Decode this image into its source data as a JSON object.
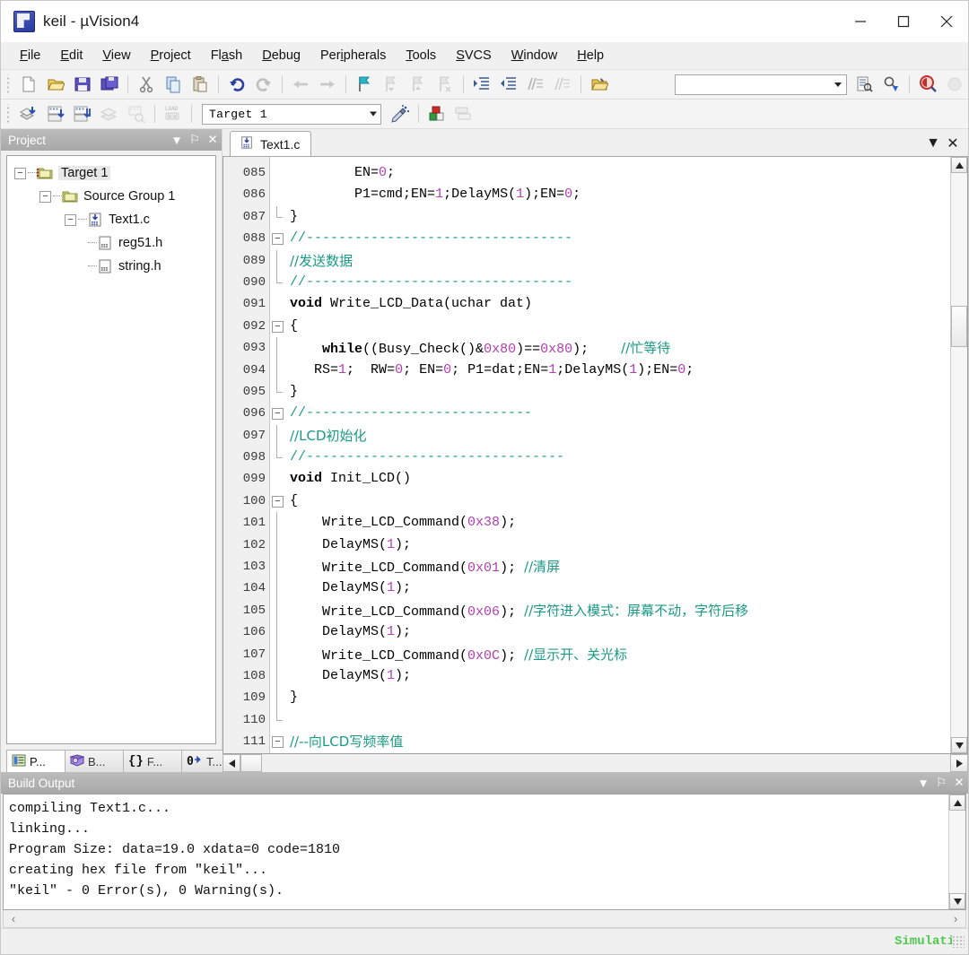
{
  "window": {
    "title": "keil  - µVision4",
    "app_icon": "keil-logo-icon",
    "minimize_label": "Minimize",
    "maximize_label": "Maximize",
    "close_label": "Close"
  },
  "menubar": {
    "items": [
      {
        "label": "File",
        "accel": "F"
      },
      {
        "label": "Edit",
        "accel": "E"
      },
      {
        "label": "View",
        "accel": "V"
      },
      {
        "label": "Project",
        "accel": "P"
      },
      {
        "label": "Flash",
        "accel": "a"
      },
      {
        "label": "Debug",
        "accel": "D"
      },
      {
        "label": "Peripherals",
        "accel": "i"
      },
      {
        "label": "Tools",
        "accel": "T"
      },
      {
        "label": "SVCS",
        "accel": "S"
      },
      {
        "label": "Window",
        "accel": "W"
      },
      {
        "label": "Help",
        "accel": "H"
      }
    ]
  },
  "toolbar_file": {
    "buttons": [
      {
        "name": "new-file-icon",
        "tooltip": "New"
      },
      {
        "name": "open-file-icon",
        "tooltip": "Open"
      },
      {
        "name": "save-icon",
        "tooltip": "Save"
      },
      {
        "name": "save-all-icon",
        "tooltip": "Save All"
      },
      {
        "name": "cut-icon",
        "tooltip": "Cut"
      },
      {
        "name": "copy-icon",
        "tooltip": "Copy"
      },
      {
        "name": "paste-icon",
        "tooltip": "Paste"
      },
      {
        "name": "undo-icon",
        "tooltip": "Undo"
      },
      {
        "name": "redo-icon",
        "tooltip": "Redo"
      },
      {
        "name": "navigate-back-icon",
        "tooltip": "Back"
      },
      {
        "name": "navigate-forward-icon",
        "tooltip": "Forward"
      },
      {
        "name": "bookmark-toggle-icon",
        "tooltip": "Insert/Remove Bookmark"
      },
      {
        "name": "bookmark-prev-icon",
        "tooltip": "Go to Previous Bookmark"
      },
      {
        "name": "bookmark-next-icon",
        "tooltip": "Go to Next Bookmark"
      },
      {
        "name": "bookmark-clear-icon",
        "tooltip": "Clear All Bookmarks"
      },
      {
        "name": "indent-icon",
        "tooltip": "Indent Selected Text"
      },
      {
        "name": "outdent-icon",
        "tooltip": "Outdent Selected Text"
      },
      {
        "name": "comment-icon",
        "tooltip": "Comment Selection"
      },
      {
        "name": "uncomment-icon",
        "tooltip": "Uncomment Selection"
      },
      {
        "name": "open-folder-icon",
        "tooltip": "Open Project"
      }
    ],
    "right_buttons": [
      {
        "name": "find-in-files-icon",
        "tooltip": "Find in Files"
      },
      {
        "name": "incremental-find-icon",
        "tooltip": "Incremental Find"
      },
      {
        "name": "find-icon",
        "tooltip": "Find"
      },
      {
        "name": "record-macro-icon",
        "tooltip": "Record Macro"
      }
    ],
    "search_value": "",
    "search_placeholder": ""
  },
  "toolbar_build": {
    "buttons": [
      {
        "name": "translate-icon",
        "tooltip": "Translate"
      },
      {
        "name": "build-target-icon",
        "tooltip": "Build Target"
      },
      {
        "name": "rebuild-all-icon",
        "tooltip": "Rebuild all target files"
      },
      {
        "name": "batch-build-icon",
        "tooltip": "Batch Build"
      },
      {
        "name": "stop-build-icon",
        "tooltip": "Stop Build"
      },
      {
        "name": "download-icon",
        "tooltip": "Download to Flash"
      }
    ],
    "target_value": "Target 1",
    "after_buttons": [
      {
        "name": "target-options-icon",
        "tooltip": "Options for Target"
      },
      {
        "name": "manage-components-icon",
        "tooltip": "Manage Components"
      },
      {
        "name": "multi-project-icon",
        "tooltip": "Manage Multi-Project"
      }
    ]
  },
  "project_panel": {
    "title": "Project",
    "header_buttons": [
      {
        "name": "panel-menu-icon",
        "label": "▼"
      },
      {
        "name": "pin-icon",
        "label": "⚐"
      },
      {
        "name": "close-panel-icon",
        "label": "✕"
      }
    ],
    "tree": [
      {
        "label": "Target 1",
        "depth": 0,
        "expander": "-",
        "icon": "target-folder-icon",
        "selected": true
      },
      {
        "label": "Source Group 1",
        "depth": 1,
        "expander": "-",
        "icon": "group-folder-icon",
        "selected": false
      },
      {
        "label": "Text1.c",
        "depth": 2,
        "expander": "-",
        "icon": "c-source-file-icon",
        "selected": false
      },
      {
        "label": "reg51.h",
        "depth": 3,
        "expander": "",
        "icon": "header-file-icon",
        "selected": false
      },
      {
        "label": "string.h",
        "depth": 3,
        "expander": "",
        "icon": "header-file-icon",
        "selected": false
      }
    ],
    "tabs": [
      {
        "label": "P...",
        "icon": "project-tab-icon",
        "active": true
      },
      {
        "label": "B...",
        "icon": "books-tab-icon",
        "active": false
      },
      {
        "label": "F...",
        "icon": "functions-tab-icon",
        "active": false
      },
      {
        "label": "T...",
        "icon": "templates-tab-icon",
        "active": false
      }
    ]
  },
  "editor": {
    "tabs": [
      {
        "label": "Text1.c",
        "icon": "c-source-file-icon",
        "active": true
      }
    ],
    "controls": [
      {
        "name": "editor-window-menu-icon",
        "label": "▼"
      },
      {
        "name": "editor-close-icon",
        "label": "✕"
      }
    ],
    "first_line_number": 85,
    "lines": [
      {
        "num": "085",
        "fold": "",
        "tokens": [
          {
            "t": "        EN",
            "c": "id"
          },
          {
            "t": "=",
            "c": "id"
          },
          {
            "t": "0",
            "c": "num"
          },
          {
            "t": ";",
            "c": "id"
          }
        ]
      },
      {
        "num": "086",
        "fold": "",
        "tokens": [
          {
            "t": "        P1",
            "c": "id"
          },
          {
            "t": "=",
            "c": "id"
          },
          {
            "t": "cmd;EN",
            "c": "id"
          },
          {
            "t": "=",
            "c": "id"
          },
          {
            "t": "1",
            "c": "num"
          },
          {
            "t": ";DelayMS(",
            "c": "id"
          },
          {
            "t": "1",
            "c": "num"
          },
          {
            "t": ");EN",
            "c": "id"
          },
          {
            "t": "=",
            "c": "id"
          },
          {
            "t": "0",
            "c": "num"
          },
          {
            "t": ";",
            "c": "id"
          }
        ]
      },
      {
        "num": "087",
        "fold": "end",
        "tokens": [
          {
            "t": "}",
            "c": "id"
          }
        ]
      },
      {
        "num": "088",
        "fold": "-",
        "tokens": [
          {
            "t": "//---------------------------------",
            "c": "cmt"
          }
        ]
      },
      {
        "num": "089",
        "fold": "|",
        "tokens": [
          {
            "t": "//发送数据",
            "c": "cmt-cn"
          }
        ]
      },
      {
        "num": "090",
        "fold": "end",
        "tokens": [
          {
            "t": "//---------------------------------",
            "c": "cmt"
          }
        ]
      },
      {
        "num": "091",
        "fold": "",
        "tokens": [
          {
            "t": "void",
            "c": "kw"
          },
          {
            "t": " Write_LCD_Data(uchar dat)",
            "c": "id"
          }
        ]
      },
      {
        "num": "092",
        "fold": "-",
        "tokens": [
          {
            "t": "{",
            "c": "id"
          }
        ]
      },
      {
        "num": "093",
        "fold": "|",
        "tokens": [
          {
            "t": "    ",
            "c": "id"
          },
          {
            "t": "while",
            "c": "kw"
          },
          {
            "t": "((Busy_Check()&",
            "c": "id"
          },
          {
            "t": "0x80",
            "c": "num"
          },
          {
            "t": ")==",
            "c": "id"
          },
          {
            "t": "0x80",
            "c": "num"
          },
          {
            "t": ");    ",
            "c": "id"
          },
          {
            "t": "//忙等待",
            "c": "cmt-cn"
          }
        ]
      },
      {
        "num": "094",
        "fold": "|",
        "tokens": [
          {
            "t": "   RS",
            "c": "id"
          },
          {
            "t": "=",
            "c": "id"
          },
          {
            "t": "1",
            "c": "num"
          },
          {
            "t": ";  RW",
            "c": "id"
          },
          {
            "t": "=",
            "c": "id"
          },
          {
            "t": "0",
            "c": "num"
          },
          {
            "t": "; EN",
            "c": "id"
          },
          {
            "t": "=",
            "c": "id"
          },
          {
            "t": "0",
            "c": "num"
          },
          {
            "t": "; P1",
            "c": "id"
          },
          {
            "t": "=",
            "c": "id"
          },
          {
            "t": "dat;EN",
            "c": "id"
          },
          {
            "t": "=",
            "c": "id"
          },
          {
            "t": "1",
            "c": "num"
          },
          {
            "t": ";DelayMS(",
            "c": "id"
          },
          {
            "t": "1",
            "c": "num"
          },
          {
            "t": ");EN",
            "c": "id"
          },
          {
            "t": "=",
            "c": "id"
          },
          {
            "t": "0",
            "c": "num"
          },
          {
            "t": ";",
            "c": "id"
          }
        ]
      },
      {
        "num": "095",
        "fold": "end",
        "tokens": [
          {
            "t": "}",
            "c": "id"
          }
        ]
      },
      {
        "num": "096",
        "fold": "-",
        "tokens": [
          {
            "t": "//----------------------------",
            "c": "cmt"
          }
        ]
      },
      {
        "num": "097",
        "fold": "|",
        "tokens": [
          {
            "t": "//LCD初始化",
            "c": "cmt-cn"
          }
        ]
      },
      {
        "num": "098",
        "fold": "end",
        "tokens": [
          {
            "t": "//--------------------------------",
            "c": "cmt"
          }
        ]
      },
      {
        "num": "099",
        "fold": "",
        "tokens": [
          {
            "t": "void",
            "c": "kw"
          },
          {
            "t": " Init_LCD()",
            "c": "id"
          }
        ]
      },
      {
        "num": "100",
        "fold": "-",
        "tokens": [
          {
            "t": "{",
            "c": "id"
          }
        ]
      },
      {
        "num": "101",
        "fold": "|",
        "tokens": [
          {
            "t": "    Write_LCD_Command(",
            "c": "id"
          },
          {
            "t": "0x38",
            "c": "num"
          },
          {
            "t": ");",
            "c": "id"
          }
        ]
      },
      {
        "num": "102",
        "fold": "|",
        "tokens": [
          {
            "t": "    DelayMS(",
            "c": "id"
          },
          {
            "t": "1",
            "c": "num"
          },
          {
            "t": ");",
            "c": "id"
          }
        ]
      },
      {
        "num": "103",
        "fold": "|",
        "tokens": [
          {
            "t": "    Write_LCD_Command(",
            "c": "id"
          },
          {
            "t": "0x01",
            "c": "num"
          },
          {
            "t": "); ",
            "c": "id"
          },
          {
            "t": "//清屏",
            "c": "cmt-cn"
          }
        ]
      },
      {
        "num": "104",
        "fold": "|",
        "tokens": [
          {
            "t": "    DelayMS(",
            "c": "id"
          },
          {
            "t": "1",
            "c": "num"
          },
          {
            "t": ");",
            "c": "id"
          }
        ]
      },
      {
        "num": "105",
        "fold": "|",
        "tokens": [
          {
            "t": "    Write_LCD_Command(",
            "c": "id"
          },
          {
            "t": "0x06",
            "c": "num"
          },
          {
            "t": "); ",
            "c": "id"
          },
          {
            "t": "//字符进入模式：屏幕不动，字符后移",
            "c": "cmt-cn"
          }
        ]
      },
      {
        "num": "106",
        "fold": "|",
        "tokens": [
          {
            "t": "    DelayMS(",
            "c": "id"
          },
          {
            "t": "1",
            "c": "num"
          },
          {
            "t": ");",
            "c": "id"
          }
        ]
      },
      {
        "num": "107",
        "fold": "|",
        "tokens": [
          {
            "t": "    Write_LCD_Command(",
            "c": "id"
          },
          {
            "t": "0x0C",
            "c": "num"
          },
          {
            "t": "); ",
            "c": "id"
          },
          {
            "t": "//显示开、关光标",
            "c": "cmt-cn"
          }
        ]
      },
      {
        "num": "108",
        "fold": "|",
        "tokens": [
          {
            "t": "    DelayMS(",
            "c": "id"
          },
          {
            "t": "1",
            "c": "num"
          },
          {
            "t": ");",
            "c": "id"
          }
        ]
      },
      {
        "num": "109",
        "fold": "|",
        "tokens": [
          {
            "t": "}",
            "c": "id"
          }
        ]
      },
      {
        "num": "110",
        "fold": "end",
        "tokens": [
          {
            "t": "",
            "c": "id"
          }
        ]
      },
      {
        "num": "111",
        "fold": "-",
        "tokens": [
          {
            "t": "//--向LCD写频率值",
            "c": "cmt-cn"
          }
        ]
      }
    ]
  },
  "build_output": {
    "title": "Build Output",
    "header_buttons": [
      {
        "name": "panel-menu-icon",
        "label": "▼"
      },
      {
        "name": "pin-icon",
        "label": "⚐"
      },
      {
        "name": "close-panel-icon",
        "label": "✕"
      }
    ],
    "lines": [
      "compiling Text1.c...",
      "linking...",
      "Program Size: data=19.0 xdata=0 code=1810",
      "creating hex file from \"keil\"...",
      "\"keil\" - 0 Error(s), 0 Warning(s)."
    ]
  },
  "statusbar": {
    "simulation_label": "Simulation",
    "simulation_color": "#4ec94e"
  }
}
